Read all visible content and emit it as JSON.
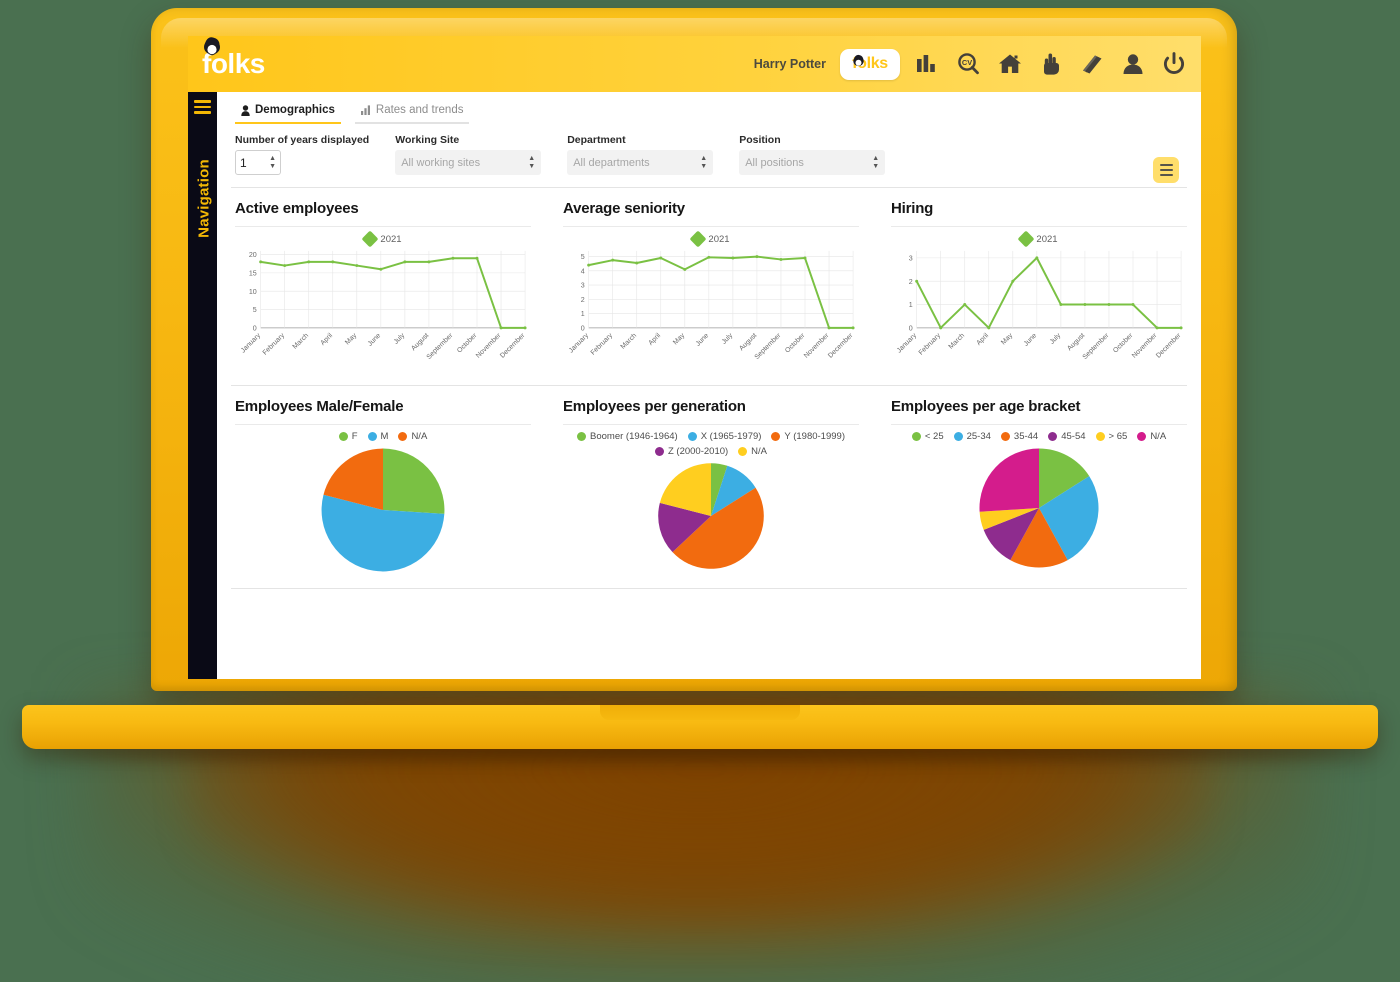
{
  "app": {
    "brand": "folks",
    "brand_logo_pill": "folks",
    "user_name": "Harry Potter"
  },
  "topbar_icons": [
    {
      "name": "folks-logo-button",
      "label": "folks"
    },
    {
      "name": "bar-chart-icon",
      "label": "Reports"
    },
    {
      "name": "cv-search-icon",
      "label": "CV Search"
    },
    {
      "name": "home-icon",
      "label": "Home"
    },
    {
      "name": "hand-pointer-icon",
      "label": "Time"
    },
    {
      "name": "book-icon",
      "label": "Directory"
    },
    {
      "name": "user-icon",
      "label": "Profile"
    },
    {
      "name": "power-icon",
      "label": "Log out"
    }
  ],
  "sidebar": {
    "label": "Navigation",
    "toggle": "menu-icon"
  },
  "tabs": [
    {
      "label": "Demographics",
      "icon": "person-icon",
      "active": true
    },
    {
      "label": "Rates and trends",
      "icon": "bar-chart-icon",
      "active": false
    }
  ],
  "filters": {
    "years": {
      "label": "Number of years displayed",
      "value": "1"
    },
    "working_site": {
      "label": "Working Site",
      "placeholder": "All working sites",
      "value": "All working sites"
    },
    "department": {
      "label": "Department",
      "placeholder": "All departments",
      "value": "All departments"
    },
    "position": {
      "label": "Position",
      "placeholder": "All positions",
      "value": "All positions"
    }
  },
  "chart_data": [
    {
      "type": "line",
      "title": "Active employees",
      "legend": [
        "2021"
      ],
      "legend_position": "top-center",
      "categories": [
        "January",
        "February",
        "March",
        "April",
        "May",
        "June",
        "July",
        "August",
        "September",
        "October",
        "November",
        "December"
      ],
      "series": [
        {
          "name": "2021",
          "values": [
            18,
            17,
            18,
            18,
            17,
            16,
            18,
            18,
            19,
            19,
            0,
            0
          ],
          "color": "#7AC143"
        }
      ],
      "yticks": [
        0,
        5,
        10,
        15,
        20
      ],
      "ylim": [
        0,
        21
      ],
      "xlabel": "",
      "ylabel": "",
      "grid": true
    },
    {
      "type": "line",
      "title": "Average seniority",
      "legend": [
        "2021"
      ],
      "legend_position": "top-center",
      "categories": [
        "January",
        "February",
        "March",
        "April",
        "May",
        "June",
        "July",
        "August",
        "September",
        "October",
        "November",
        "December"
      ],
      "series": [
        {
          "name": "2021",
          "values": [
            4.4,
            4.75,
            4.55,
            4.9,
            4.1,
            4.95,
            4.9,
            5.0,
            4.8,
            4.9,
            0,
            0
          ],
          "color": "#7AC143"
        }
      ],
      "yticks": [
        0,
        1,
        2,
        3,
        4,
        5
      ],
      "ylim": [
        0,
        5.4
      ],
      "xlabel": "",
      "ylabel": "",
      "grid": true
    },
    {
      "type": "line",
      "title": "Hiring",
      "legend": [
        "2021"
      ],
      "legend_position": "top-center",
      "categories": [
        "January",
        "February",
        "March",
        "April",
        "May",
        "June",
        "July",
        "August",
        "September",
        "October",
        "November",
        "December"
      ],
      "series": [
        {
          "name": "2021",
          "values": [
            2,
            0,
            1,
            0,
            2,
            3,
            1,
            1,
            1,
            1,
            0,
            0
          ],
          "color": "#7AC143"
        }
      ],
      "yticks": [
        0,
        1,
        2,
        3
      ],
      "ylim": [
        0,
        3.3
      ],
      "xlabel": "",
      "ylabel": "",
      "grid": true
    },
    {
      "type": "pie",
      "title": "Employees Male/Female",
      "legend_position": "top-center",
      "labels": [
        "F",
        "M",
        "N/A"
      ],
      "values": [
        26,
        53,
        21
      ],
      "colors": [
        "#7AC143",
        "#3CAEE3",
        "#F26B0F"
      ]
    },
    {
      "type": "pie",
      "title": "Employees per generation",
      "legend_position": "top-center",
      "labels": [
        "Boomer (1946-1964)",
        "X (1965-1979)",
        "Y (1980-1999)",
        "Z (2000-2010)",
        "N/A"
      ],
      "values": [
        5,
        11,
        47,
        16,
        21
      ],
      "colors": [
        "#7AC143",
        "#3CAEE3",
        "#F26B0F",
        "#8E2C8E",
        "#FFCE1F"
      ]
    },
    {
      "type": "pie",
      "title": "Employees per age bracket",
      "legend_position": "top-center",
      "labels": [
        "< 25",
        "25-34",
        "35-44",
        "45-54",
        "> 65",
        "N/A"
      ],
      "values": [
        16,
        26,
        16,
        11,
        5,
        26
      ],
      "colors": [
        "#7AC143",
        "#3CAEE3",
        "#F26B0F",
        "#8E2C8E",
        "#FFCE1F",
        "#D41C8C"
      ]
    }
  ],
  "colors": {
    "brand_yellow": "#FFC61A",
    "accent_green": "#7AC143",
    "sidebar_bg": "#0A0A16",
    "sidebar_text": "#F2B705",
    "page_bg": "#4A7050"
  }
}
